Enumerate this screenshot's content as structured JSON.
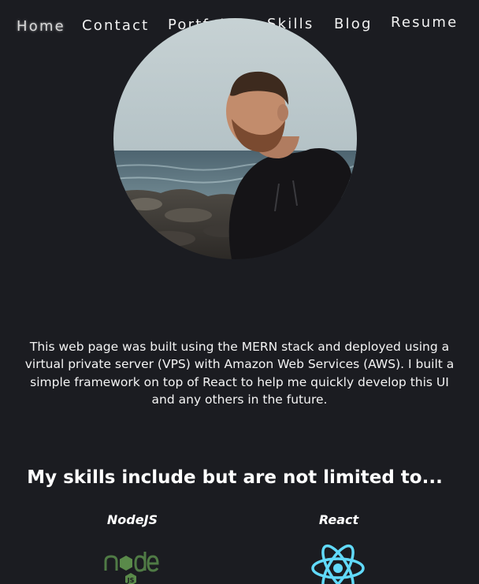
{
  "nav": {
    "items": [
      {
        "label": "Home"
      },
      {
        "label": "Contact"
      },
      {
        "label": "Portfolio"
      },
      {
        "label": "Skills"
      },
      {
        "label": "Blog"
      },
      {
        "label": "Resume"
      }
    ]
  },
  "about": {
    "text": "This web page was built using the MERN stack and deployed using a virtual private server (VPS) with Amazon Web Services (AWS). I built a simple framework on top of React to help me quickly develop this UI and any others in the future."
  },
  "skills": {
    "heading": "My skills include but are not limited to...",
    "items": [
      {
        "label": "NodeJS",
        "icon": "nodejs-icon"
      },
      {
        "label": "React",
        "icon": "react-icon"
      }
    ]
  },
  "colors": {
    "background": "#1b1c21",
    "text": "#ffffff",
    "react_accent": "#61dafb",
    "node_accent": "#5a8a4a"
  }
}
